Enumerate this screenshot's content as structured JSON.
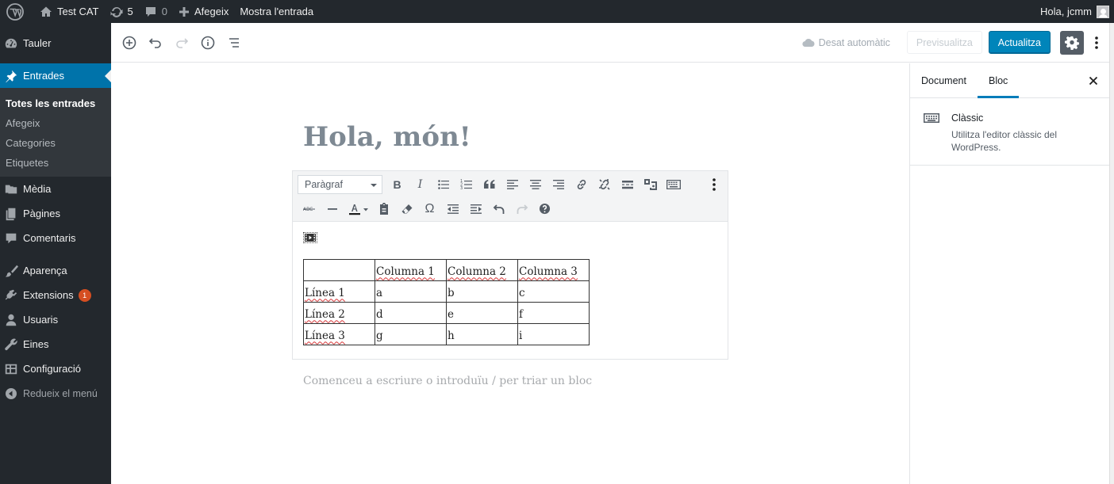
{
  "adminbar": {
    "site_name": "Test CAT",
    "updates_count": "5",
    "comments_count": "0",
    "new_label": "Afegeix",
    "view_post_label": "Mostra l'entrada",
    "greeting": "Hola, jcmm"
  },
  "sidebar": {
    "dashboard": "Tauler",
    "posts": "Entrades",
    "posts_sub": [
      "Totes les entrades",
      "Afegeix",
      "Categories",
      "Etiquetes"
    ],
    "media": "Mèdia",
    "pages": "Pàgines",
    "comments": "Comentaris",
    "appearance": "Aparença",
    "plugins": "Extensions",
    "plugins_badge": "1",
    "users": "Usuaris",
    "tools": "Eines",
    "settings": "Configuració",
    "collapse": "Redueix el menú"
  },
  "header": {
    "saved_label": "Desat automàtic",
    "preview_label": "Previsualitza",
    "update_label": "Actualitza"
  },
  "post": {
    "title": "Hola, món!",
    "appender_placeholder": "Comenceu a escriure o introduïu / per triar un bloc"
  },
  "classic_toolbar": {
    "format_value": "Paràgraf"
  },
  "table": {
    "rows": [
      [
        "",
        "Columna 1",
        "Columna 2",
        "Columna 3"
      ],
      [
        "Línea 1",
        "a",
        "b",
        "c"
      ],
      [
        "Línea 2",
        "d",
        "e",
        "f"
      ],
      [
        "Línea 3",
        "g",
        "h",
        "i"
      ]
    ]
  },
  "settings_panel": {
    "tab_document": "Document",
    "tab_block": "Bloc",
    "block_title": "Clàssic",
    "block_description": "Utilitza l'editor clàssic del WordPress."
  },
  "colors": {
    "admin_dark": "#23282d",
    "accent": "#0073aa",
    "update_button": "#0085ba",
    "badge": "#d54e21"
  }
}
